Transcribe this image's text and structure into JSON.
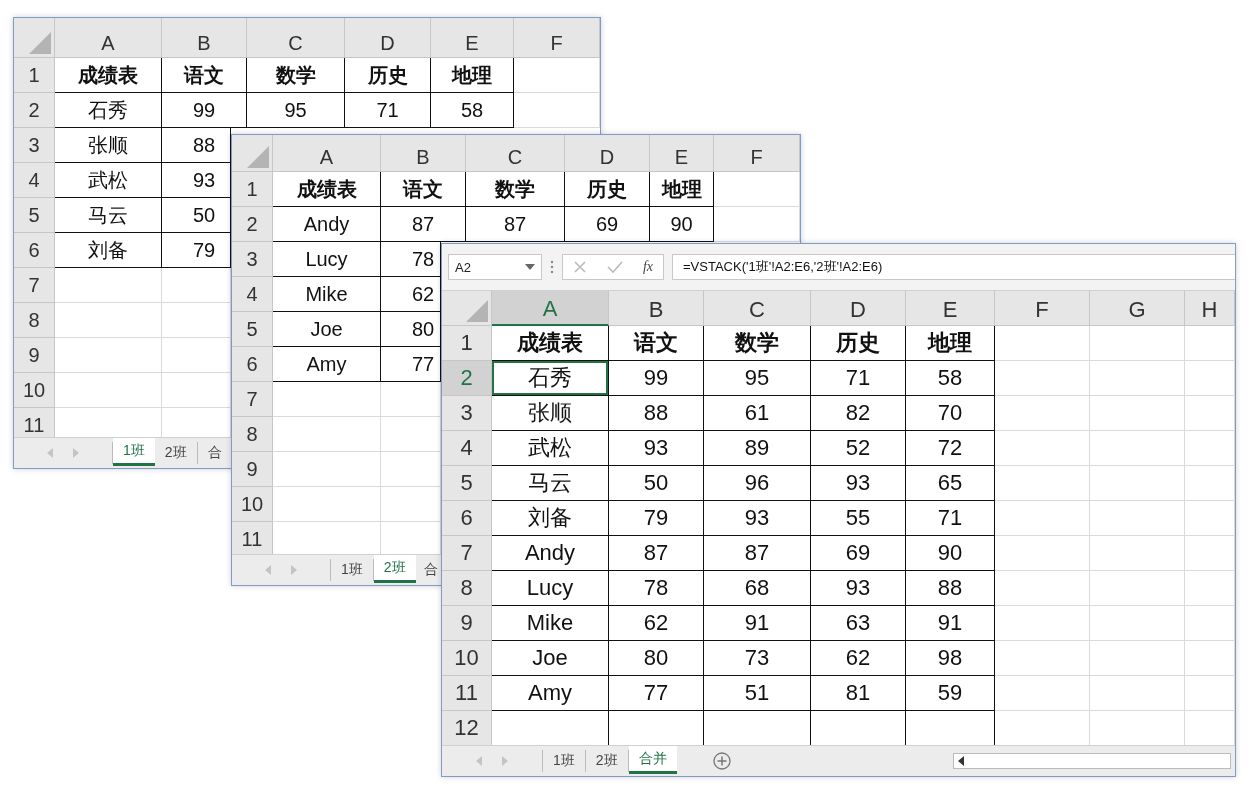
{
  "windows": [
    {
      "columns": [
        {
          "label": "A",
          "selected": false
        },
        {
          "label": "B",
          "selected": false
        },
        {
          "label": "C",
          "selected": false
        },
        {
          "label": "D",
          "selected": false
        },
        {
          "label": "E",
          "selected": false
        },
        {
          "label": "F",
          "selected": false
        }
      ],
      "rows": [
        {
          "header": "1",
          "selected": false,
          "kind": "heading",
          "cells": [
            "成绩表",
            "语文",
            "数学",
            "历史",
            "地理"
          ]
        },
        {
          "header": "2",
          "selected": false,
          "kind": "data",
          "cells": [
            "石秀",
            "99",
            "95",
            "71",
            "58"
          ]
        },
        {
          "header": "3",
          "selected": false,
          "kind": "data",
          "cells": [
            "张顺",
            "88"
          ]
        },
        {
          "header": "4",
          "selected": false,
          "kind": "data",
          "cells": [
            "武松",
            "93"
          ]
        },
        {
          "header": "5",
          "selected": false,
          "kind": "data",
          "cells": [
            "马云",
            "50"
          ]
        },
        {
          "header": "6",
          "selected": false,
          "kind": "data",
          "cells": [
            "刘备",
            "79"
          ]
        },
        {
          "header": "7",
          "selected": false,
          "kind": "empty"
        },
        {
          "header": "8",
          "selected": false,
          "kind": "empty"
        },
        {
          "header": "9",
          "selected": false,
          "kind": "empty"
        },
        {
          "header": "10",
          "selected": false,
          "kind": "empty"
        },
        {
          "header": "11",
          "selected": false,
          "kind": "empty"
        }
      ],
      "tabs": [
        {
          "label": "1班",
          "selected": true
        },
        {
          "label": "2班",
          "selected": false
        },
        {
          "label": "合",
          "selected": false
        }
      ]
    },
    {
      "columns": [
        {
          "label": "A",
          "selected": false
        },
        {
          "label": "B",
          "selected": false
        },
        {
          "label": "C",
          "selected": false
        },
        {
          "label": "D",
          "selected": false
        },
        {
          "label": "E",
          "selected": false
        },
        {
          "label": "F",
          "selected": false
        }
      ],
      "rows": [
        {
          "header": "1",
          "selected": false,
          "kind": "heading",
          "cells": [
            "成绩表",
            "语文",
            "数学",
            "历史",
            "地理"
          ]
        },
        {
          "header": "2",
          "selected": false,
          "kind": "data",
          "cells": [
            "Andy",
            "87",
            "87",
            "69",
            "90"
          ]
        },
        {
          "header": "3",
          "selected": false,
          "kind": "data",
          "cells": [
            "Lucy",
            "78"
          ]
        },
        {
          "header": "4",
          "selected": false,
          "kind": "data",
          "cells": [
            "Mike",
            "62"
          ]
        },
        {
          "header": "5",
          "selected": false,
          "kind": "data",
          "cells": [
            "Joe",
            "80"
          ]
        },
        {
          "header": "6",
          "selected": false,
          "kind": "data",
          "cells": [
            "Amy",
            "77"
          ]
        },
        {
          "header": "7",
          "selected": false,
          "kind": "empty"
        },
        {
          "header": "8",
          "selected": false,
          "kind": "empty"
        },
        {
          "header": "9",
          "selected": false,
          "kind": "empty"
        },
        {
          "header": "10",
          "selected": false,
          "kind": "empty"
        },
        {
          "header": "11",
          "selected": false,
          "kind": "empty"
        }
      ],
      "tabs": [
        {
          "label": "1班",
          "selected": false
        },
        {
          "label": "2班",
          "selected": true
        },
        {
          "label": "合",
          "selected": false
        }
      ]
    },
    {
      "name_box": "A2",
      "function_label": "fx",
      "formula": "=VSTACK('1班'!A2:E6,'2班'!A2:E6)",
      "columns": [
        {
          "label": "A",
          "selected": true
        },
        {
          "label": "B",
          "selected": false
        },
        {
          "label": "C",
          "selected": false
        },
        {
          "label": "D",
          "selected": false
        },
        {
          "label": "E",
          "selected": false
        },
        {
          "label": "F",
          "selected": false
        },
        {
          "label": "G",
          "selected": false
        },
        {
          "label": "H",
          "selected": false
        }
      ],
      "rows": [
        {
          "header": "1",
          "selected": false,
          "kind": "heading",
          "cells": [
            "成绩表",
            "语文",
            "数学",
            "历史",
            "地理"
          ]
        },
        {
          "header": "2",
          "selected": true,
          "kind": "data",
          "cells": [
            "石秀",
            "99",
            "95",
            "71",
            "58"
          ]
        },
        {
          "header": "3",
          "selected": false,
          "kind": "data",
          "cells": [
            "张顺",
            "88",
            "61",
            "82",
            "70"
          ]
        },
        {
          "header": "4",
          "selected": false,
          "kind": "data",
          "cells": [
            "武松",
            "93",
            "89",
            "52",
            "72"
          ]
        },
        {
          "header": "5",
          "selected": false,
          "kind": "data",
          "cells": [
            "马云",
            "50",
            "96",
            "93",
            "65"
          ]
        },
        {
          "header": "6",
          "selected": false,
          "kind": "data",
          "cells": [
            "刘备",
            "79",
            "93",
            "55",
            "71"
          ]
        },
        {
          "header": "7",
          "selected": false,
          "kind": "data",
          "cells": [
            "Andy",
            "87",
            "87",
            "69",
            "90"
          ]
        },
        {
          "header": "8",
          "selected": false,
          "kind": "data",
          "cells": [
            "Lucy",
            "78",
            "68",
            "93",
            "88"
          ]
        },
        {
          "header": "9",
          "selected": false,
          "kind": "data",
          "cells": [
            "Mike",
            "62",
            "91",
            "63",
            "91"
          ]
        },
        {
          "header": "10",
          "selected": false,
          "kind": "data",
          "cells": [
            "Joe",
            "80",
            "73",
            "62",
            "98"
          ]
        },
        {
          "header": "11",
          "selected": false,
          "kind": "data",
          "cells": [
            "Amy",
            "77",
            "51",
            "81",
            "59"
          ]
        },
        {
          "header": "12",
          "selected": false,
          "kind": "data",
          "cells": []
        }
      ],
      "tabs": [
        {
          "label": "1班",
          "selected": false
        },
        {
          "label": "2班",
          "selected": false
        },
        {
          "label": "合并",
          "selected": true
        }
      ],
      "add_sheet": true
    }
  ]
}
